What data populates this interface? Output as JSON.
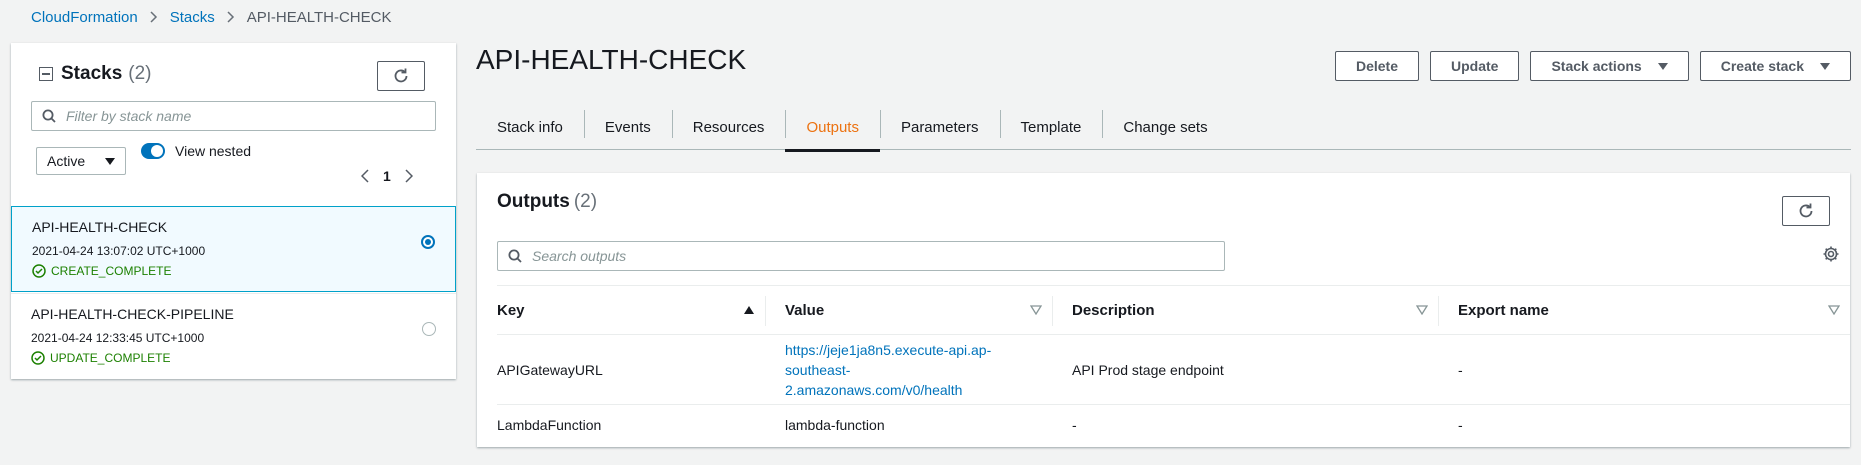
{
  "breadcrumb": {
    "items": [
      "CloudFormation",
      "Stacks"
    ],
    "current": "API-HEALTH-CHECK"
  },
  "stacks_panel": {
    "title": "Stacks",
    "count": "(2)",
    "search_placeholder": "Filter by stack name",
    "filter_value": "Active",
    "toggle_label": "View nested",
    "toggle_on": true,
    "page": "1",
    "items": [
      {
        "name": "API-HEALTH-CHECK",
        "date": "2021-04-24 13:07:02 UTC+1000",
        "status": "CREATE_COMPLETE",
        "selected": true
      },
      {
        "name": "API-HEALTH-CHECK-PIPELINE",
        "date": "2021-04-24 12:33:45 UTC+1000",
        "status": "UPDATE_COMPLETE",
        "selected": false
      }
    ]
  },
  "page_title": "API-HEALTH-CHECK",
  "actions": {
    "delete": "Delete",
    "update": "Update",
    "stack_actions": "Stack actions",
    "create_stack": "Create stack"
  },
  "tabs": [
    {
      "label": "Stack info",
      "active": false
    },
    {
      "label": "Events",
      "active": false
    },
    {
      "label": "Resources",
      "active": false
    },
    {
      "label": "Outputs",
      "active": true
    },
    {
      "label": "Parameters",
      "active": false
    },
    {
      "label": "Template",
      "active": false
    },
    {
      "label": "Change sets",
      "active": false
    }
  ],
  "outputs": {
    "title": "Outputs",
    "count": "(2)",
    "search_placeholder": "Search outputs",
    "columns": [
      "Key",
      "Value",
      "Description",
      "Export name"
    ],
    "rows": [
      {
        "key": "APIGatewayURL",
        "value": "https://jeje1ja8n5.execute-api.ap-southeast-2.amazonaws.com/v0/health",
        "value_lines": [
          "https://jeje1ja8n5.execute-api.ap-",
          "southeast-",
          "2.amazonaws.com/v0/health"
        ],
        "value_is_link": true,
        "description": "API Prod stage endpoint",
        "export": "-"
      },
      {
        "key": "LambdaFunction",
        "value": "lambda-function",
        "value_is_link": false,
        "description": "-",
        "export": "-"
      }
    ]
  },
  "colors": {
    "link": "#0073bb",
    "accent": "#ec7211",
    "success": "#1d8102",
    "selected_bg": "#f1faff",
    "selected_border": "#00a1c9"
  }
}
